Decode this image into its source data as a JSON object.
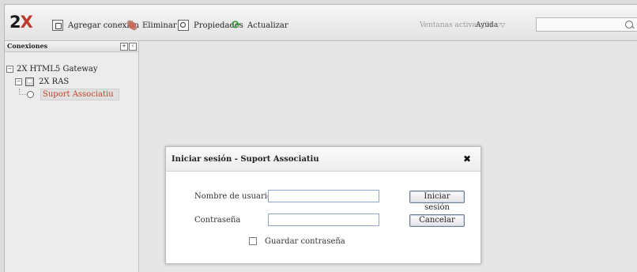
{
  "toolbar": {
    "logo": {
      "main": "2",
      "accent": "X"
    },
    "add_connection": "Agregar conexión",
    "delete": "Eliminar",
    "properties": "Propiedades",
    "refresh": "Actualizar",
    "active_windows": "Ventanas activas (0)",
    "help": "Ayuda",
    "search_value": ""
  },
  "panel": {
    "title": "Conexiones",
    "tree": {
      "gateway": "2X HTML5 Gateway",
      "ras": "2X RAS",
      "connection": "Suport Associatiu"
    }
  },
  "dialog": {
    "title": "Iniciar sesión - Suport Associatiu",
    "username_label": "Nombre de usuario",
    "username_value": "",
    "password_label": "Contraseña",
    "password_value": "",
    "login_button": "Iniciar sesión",
    "cancel_button": "Cancelar",
    "remember_label": "Guardar contraseña",
    "remember_checked": false
  },
  "colors": {
    "accent": "#c0392b",
    "refresh_icon": "#3c9a3c",
    "field_border": "#8fa6c9"
  }
}
